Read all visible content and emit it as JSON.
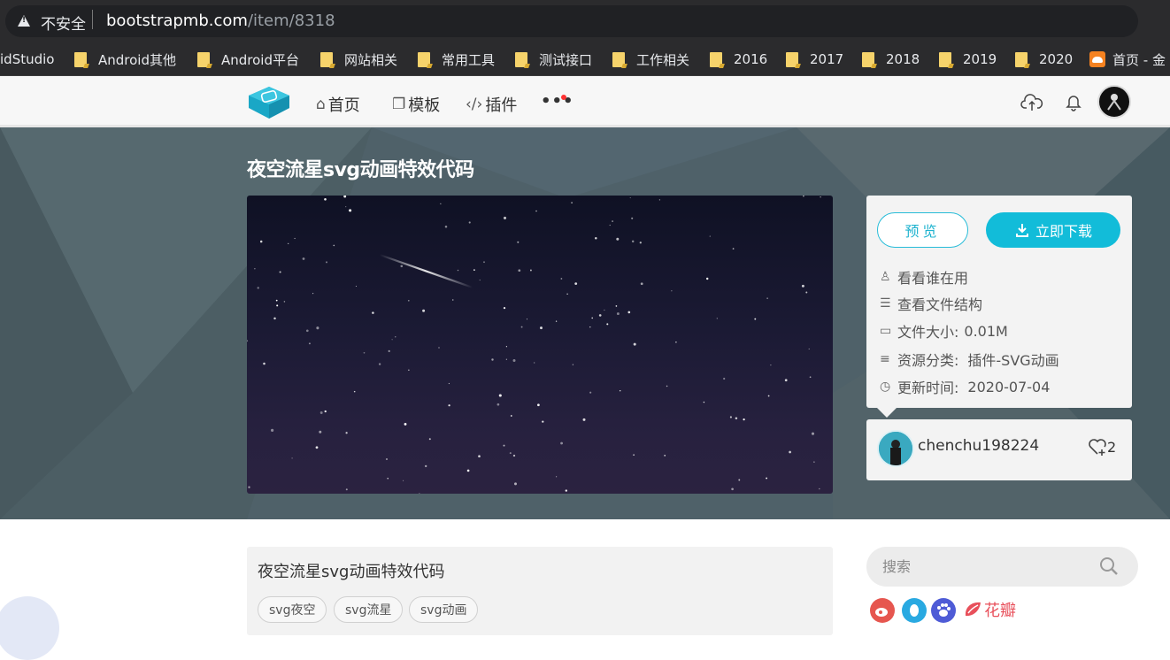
{
  "browser": {
    "security_label": "不安全",
    "url_host": "bootstrapmb.com",
    "url_path": "/item/8318"
  },
  "bookmarks": [
    {
      "label": "idStudio",
      "icon": "none"
    },
    {
      "label": "Android其他",
      "icon": "folder-icon"
    },
    {
      "label": "Android平台",
      "icon": "folder-icon"
    },
    {
      "label": "网站相关",
      "icon": "folder-icon"
    },
    {
      "label": "常用工具",
      "icon": "folder-icon"
    },
    {
      "label": "测试接口",
      "icon": "folder-icon"
    },
    {
      "label": "工作相关",
      "icon": "folder-icon"
    },
    {
      "label": "2016",
      "icon": "folder-icon"
    },
    {
      "label": "2017",
      "icon": "folder-icon"
    },
    {
      "label": "2018",
      "icon": "folder-icon"
    },
    {
      "label": "2019",
      "icon": "folder-icon"
    },
    {
      "label": "2020",
      "icon": "folder-icon"
    },
    {
      "label": "首页 - 金",
      "icon": "site-icon"
    }
  ],
  "nav": {
    "home": "首页",
    "templates": "模板",
    "plugins": "插件",
    "more": "•••"
  },
  "item": {
    "title": "夜空流星svg动画特效代码",
    "preview_button": "预览",
    "download_button": "立即下载",
    "who_uses": "看看谁在用",
    "file_structure": "查看文件结构",
    "file_size_label": "文件大小:",
    "file_size_value": "0.01M",
    "category_label": "资源分类:",
    "category_value": "插件-SVG动画",
    "updated_label": "更新时间:",
    "updated_value": "2020-07-04"
  },
  "author": {
    "username": "chenchu198224",
    "like_count": "2"
  },
  "content": {
    "title": "夜空流星svg动画特效代码",
    "tags": [
      "svg夜空",
      "svg流星",
      "svg动画"
    ]
  },
  "sidebar": {
    "search_placeholder": "搜索",
    "huaban_label": "花瓣"
  },
  "colors": {
    "accent": "#12bcd9",
    "banner": "#4f6169"
  }
}
